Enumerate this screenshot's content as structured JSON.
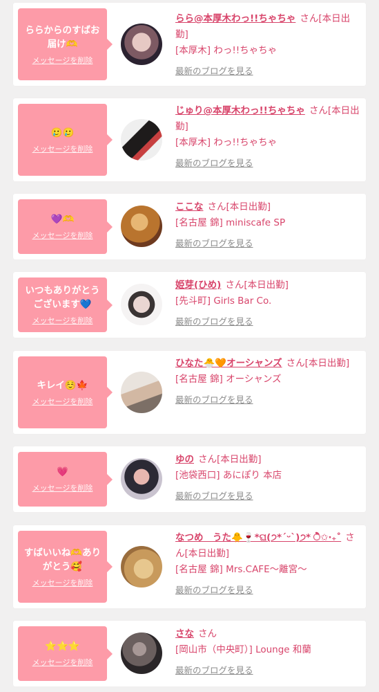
{
  "cards": [
    {
      "message": "ららからのすばお届け🫶",
      "delete_label": "メッセージを削除",
      "name": "らら@本厚木わっ!!ちゃちゃ",
      "honorific": "さん",
      "status": "[本日出勤]",
      "shop": "[本厚木] わっ!!ちゃちゃ",
      "blog_label": "最新のブログを見る",
      "avatar_colors": [
        "#2b2230",
        "#e6c9c4",
        "#7d5a63"
      ]
    },
    {
      "message": "🥲🥲",
      "delete_label": "メッセージを削除",
      "name": "じゅり@本厚木わっ!!ちゃちゃ",
      "honorific": "さん",
      "status": "[本日出勤]",
      "shop": "[本厚木] わっ!!ちゃちゃ",
      "blog_label": "最新のブログを見る",
      "avatar_colors": [
        "#efefef",
        "#1e1b1b",
        "#c74040"
      ]
    },
    {
      "message": "💜🫶",
      "delete_label": "メッセージを削除",
      "name": "ここな",
      "honorific": "さん",
      "status": "[本日出勤]",
      "shop": "[名古屋 錦] miniscafe SP",
      "blog_label": "最新のブログを見る",
      "avatar_colors": [
        "#b9742e",
        "#6e3a1f",
        "#e7b774"
      ]
    },
    {
      "message": "いつもありがとうございます💙",
      "delete_label": "メッセージを削除",
      "name": "姫芽(ひめ)",
      "honorific": "さん",
      "status": "[本日出勤]",
      "shop": "[先斗町] Girls Bar Co.",
      "blog_label": "最新のブログを見る",
      "avatar_colors": [
        "#f5f3f3",
        "#3a3434",
        "#e9d6d2"
      ]
    },
    {
      "message": "キレイ☺️🍁",
      "delete_label": "メッセージを削除",
      "name": "ひなた🐣🧡オーシャンズ",
      "honorific": "さん",
      "status": "[本日出勤]",
      "shop": "[名古屋 錦] オーシャンズ",
      "blog_label": "最新のブログを見る",
      "avatar_colors": [
        "#e9e3dd",
        "#7c6f66",
        "#d2b8a3"
      ]
    },
    {
      "message": "💗",
      "delete_label": "メッセージを削除",
      "name": "ゆの",
      "honorific": "さん",
      "status": "[本日出勤]",
      "shop": "[池袋西口] あにぽり 本店",
      "blog_label": "最新のブログを見る",
      "avatar_colors": [
        "#2c2a35",
        "#c9c3cf",
        "#e8b7b0"
      ]
    },
    {
      "message": "すばいいね🫶ありがとう🥰",
      "delete_label": "メッセージを削除",
      "name": "なつめ　うた🐥🍷*ଘ(੭*ˊᵕˋ)੭* ੈ✩‧₊˚",
      "honorific": "さん",
      "status": "[本日出勤]",
      "shop": "[名古屋 錦] Mrs.CAFE〜離宮〜",
      "blog_label": "最新のブログを見る",
      "avatar_colors": [
        "#c89a5c",
        "#e7c78e",
        "#9a6d3d"
      ]
    },
    {
      "message": "⭐️⭐️⭐️",
      "delete_label": "メッセージを削除",
      "name": "さな",
      "honorific": "さん",
      "status": "",
      "shop": "[岡山市（中央町）] Lounge 和蘭",
      "blog_label": "最新のブログを見る",
      "avatar_colors": [
        "#2a2628",
        "#6a5f5e",
        "#a79896"
      ]
    }
  ]
}
